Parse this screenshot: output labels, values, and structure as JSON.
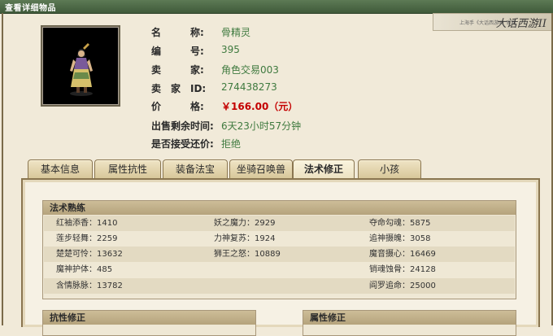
{
  "window": {
    "title": "查看详细物品"
  },
  "branding": {
    "subtitle": "上海手《大话西游II》官网",
    "logo_text": "大话西游II"
  },
  "item": {
    "fields": [
      {
        "label": "名　　　称:",
        "value": "骨精灵"
      },
      {
        "label": "编　　　号:",
        "value": "395"
      },
      {
        "label": "卖　　　家:",
        "value": "角色交易003"
      },
      {
        "label": "卖　家　ID:",
        "value": "274438273"
      },
      {
        "label": "价　　　格:",
        "value": "￥166.00（元）"
      },
      {
        "label": "出售剩余时间:",
        "value": "6天23小时57分钟"
      },
      {
        "label": "是否接受还价:",
        "value": "拒绝"
      }
    ]
  },
  "tabs": [
    {
      "label": "基本信息"
    },
    {
      "label": "属性抗性"
    },
    {
      "label": "装备法宝"
    },
    {
      "label": "坐骑召唤兽"
    },
    {
      "label": "法术修正"
    },
    {
      "label": "小孩"
    }
  ],
  "active_tab_index": 4,
  "skills_section": {
    "title": "法术熟练",
    "rows": [
      [
        "红袖添香：1410",
        "妖之魔力：2929",
        "夺命勾魂：5875"
      ],
      [
        "莲步轻舞：2259",
        "力神复苏：1924",
        "追神摄魄：3058"
      ],
      [
        "楚楚可怜：13632",
        "狮王之怒：10889",
        "魔音摄心：16469"
      ],
      [
        "魔神护体：485",
        "",
        "销魂蚀骨：24128"
      ],
      [
        "含情脉脉：13782",
        "",
        "阎罗追命：25000"
      ]
    ]
  },
  "bottom_sections": {
    "left_title": "抗性修正",
    "right_title": "属性修正"
  }
}
